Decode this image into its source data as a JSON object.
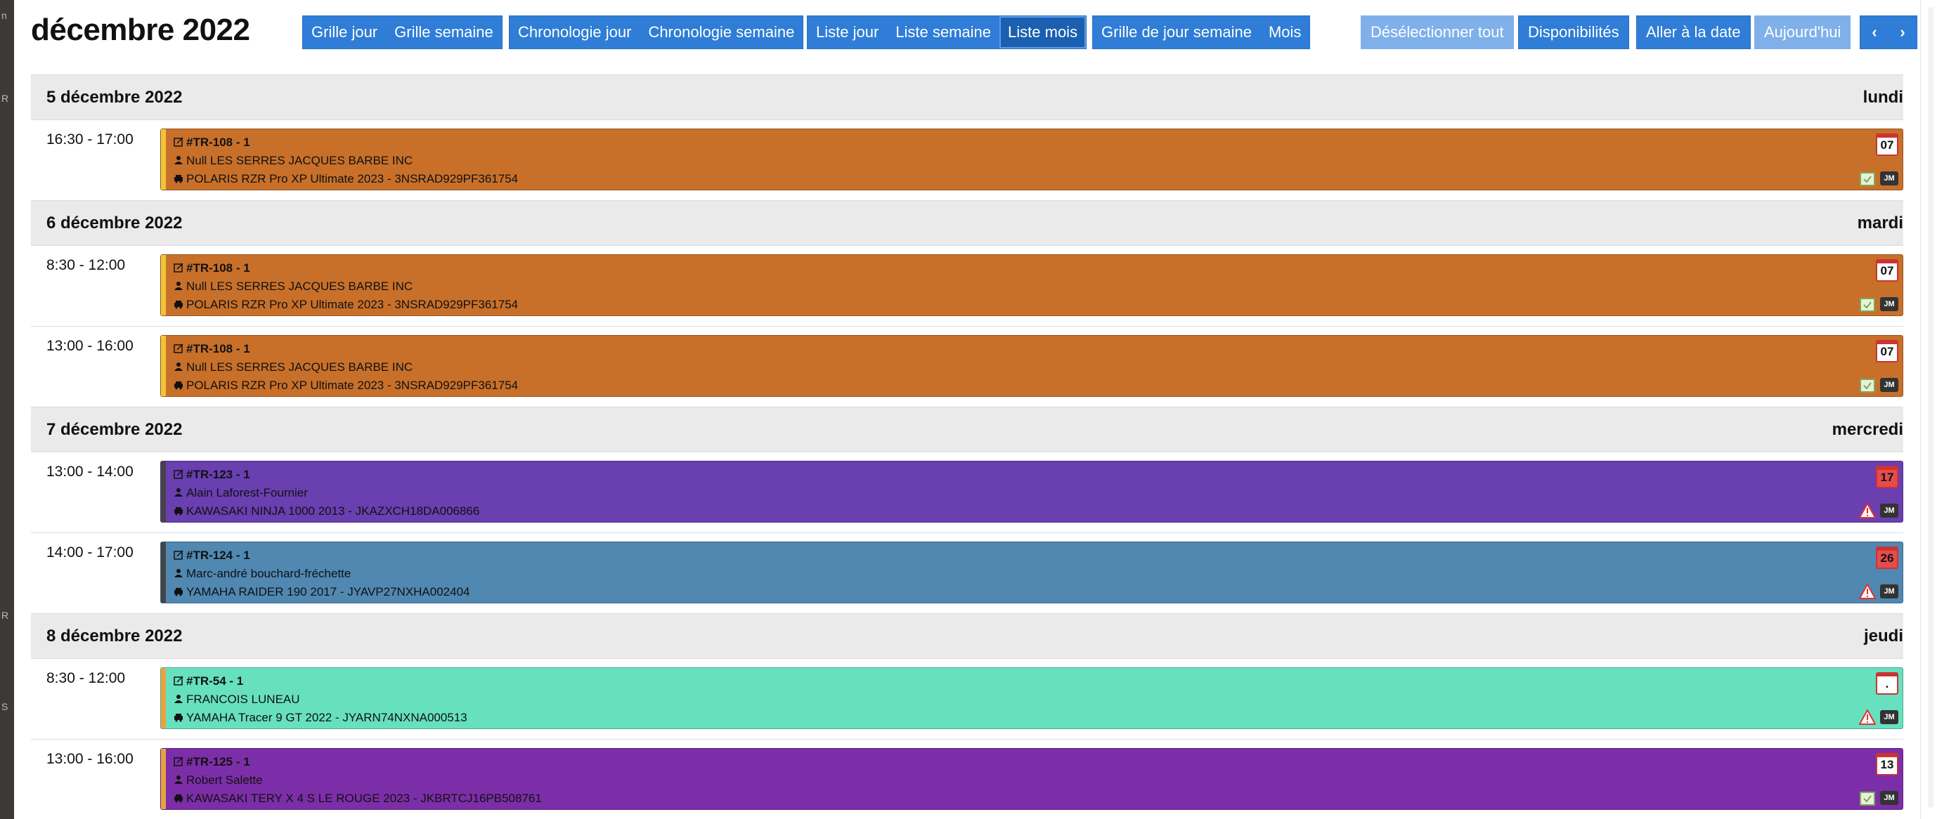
{
  "title": "décembre 2022",
  "toolbar": {
    "group1": [
      "Grille jour",
      "Grille semaine"
    ],
    "group2": [
      "Chronologie jour",
      "Chronologie semaine"
    ],
    "group3": [
      "Liste jour",
      "Liste semaine",
      "Liste mois"
    ],
    "group4": [
      "Grille de jour semaine",
      "Mois"
    ],
    "deselect": "Désélectionner tout",
    "availability": "Disponibilités",
    "goto_date": "Aller à la date",
    "today": "Aujourd'hui",
    "prev": "‹",
    "next": "›",
    "active_view": "Liste mois"
  },
  "sidebar_letters": [
    "n",
    "R",
    "R",
    "S"
  ],
  "colors": {
    "button": "#2f7dd6",
    "button_disabled": "#7fb0ea",
    "orange": "#c8702a",
    "purple": "#6a3fb0",
    "steel_blue": "#5088b2",
    "teal": "#67e0bf",
    "magenta": "#7c2ea8"
  },
  "days": [
    {
      "date": "5 décembre 2022",
      "weekday": "lundi",
      "events": [
        {
          "time": "16:30 - 17:00",
          "id": "#TR-108 - 1",
          "client": "Null LES SERRES JACQUES BARBE INC",
          "vehicle": "POLARIS RZR Pro XP Ultimate 2023 - 3NSRAD929PF361754",
          "badge": "07",
          "badge_style": "white",
          "status": "calendar-check-icon",
          "color": "#c8702a",
          "stripe": "#f0c53a"
        }
      ]
    },
    {
      "date": "6 décembre 2022",
      "weekday": "mardi",
      "events": [
        {
          "time": "8:30 - 12:00",
          "id": "#TR-108 - 1",
          "client": "Null LES SERRES JACQUES BARBE INC",
          "vehicle": "POLARIS RZR Pro XP Ultimate 2023 - 3NSRAD929PF361754",
          "badge": "07",
          "badge_style": "white",
          "status": "calendar-check-icon",
          "color": "#c8702a",
          "stripe": "#f0c53a"
        },
        {
          "time": "13:00 - 16:00",
          "id": "#TR-108 - 1",
          "client": "Null LES SERRES JACQUES BARBE INC",
          "vehicle": "POLARIS RZR Pro XP Ultimate 2023 - 3NSRAD929PF361754",
          "badge": "07",
          "badge_style": "white",
          "status": "calendar-check-icon",
          "color": "#c8702a",
          "stripe": "#f0c53a"
        }
      ]
    },
    {
      "date": "7 décembre 2022",
      "weekday": "mercredi",
      "events": [
        {
          "time": "13:00 - 14:00",
          "id": "#TR-123 - 1",
          "client": "Alain Laforest-Fournier",
          "vehicle": "KAWASAKI NINJA 1000 2013 - JKAZXCH18DA006866",
          "badge": "17",
          "badge_style": "red",
          "status": "warning-icon",
          "color": "#6a3fb0",
          "stripe": "#444444"
        },
        {
          "time": "14:00 - 17:00",
          "id": "#TR-124 - 1",
          "client": "Marc-andré bouchard-fréchette",
          "vehicle": "YAMAHA RAIDER 190 2017 - JYAVP27NXHA002404",
          "badge": "26",
          "badge_style": "red",
          "status": "warning-icon",
          "color": "#5088b2",
          "stripe": "#444444"
        }
      ]
    },
    {
      "date": "8 décembre 2022",
      "weekday": "jeudi",
      "events": [
        {
          "time": "8:30 - 12:00",
          "id": "#TR-54 - 1",
          "client": "FRANCOIS LUNEAU",
          "vehicle": "YAMAHA Tracer 9 GT 2022 - JYARN74NXNA000513",
          "badge": ".",
          "badge_style": "white",
          "status": "warning-icon",
          "color": "#67e0bf",
          "stripe": "#e8a341"
        },
        {
          "time": "13:00 - 16:00",
          "id": "#TR-125 - 1",
          "client": "Robert Salette",
          "vehicle": "KAWASAKI TERY X 4 S LE ROUGE 2023 - JKBRTCJ16PB508761",
          "badge": "13",
          "badge_style": "white",
          "status": "calendar-check-icon",
          "color": "#7c2ea8",
          "stripe": "#e8a341"
        }
      ]
    }
  ],
  "assignee_badge": "JM"
}
